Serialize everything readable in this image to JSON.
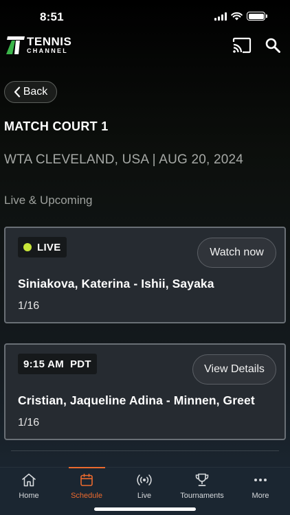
{
  "status_bar": {
    "time": "8:51"
  },
  "header": {
    "logo_line1": "TENNIS",
    "logo_line2": "CHANNEL",
    "accent_color": "#3bb54a"
  },
  "back_label": "Back",
  "court_title": "MATCH COURT 1",
  "tournament_info": "WTA CLEVELAND, USA | AUG 20, 2024",
  "section_label": "Live & Upcoming",
  "matches": [
    {
      "badge": "LIVE",
      "badge_color": "#c8e639",
      "button_label": "Watch now",
      "players": "Siniakova, Katerina - Ishii, Sayaka",
      "round": "1/16"
    },
    {
      "badge": "9:15 AM  PDT",
      "button_label": "View Details",
      "players": "Cristian, Jaqueline Adina - Minnen, Greet",
      "round": "1/16"
    }
  ],
  "tab_bar": {
    "active_color": "#ec6a2e",
    "tabs": [
      {
        "label": "Home",
        "icon": "home-icon"
      },
      {
        "label": "Schedule",
        "icon": "calendar-icon",
        "active": true
      },
      {
        "label": "Live",
        "icon": "broadcast-icon"
      },
      {
        "label": "Tournaments",
        "icon": "trophy-icon"
      },
      {
        "label": "More",
        "icon": "more-icon"
      }
    ]
  }
}
